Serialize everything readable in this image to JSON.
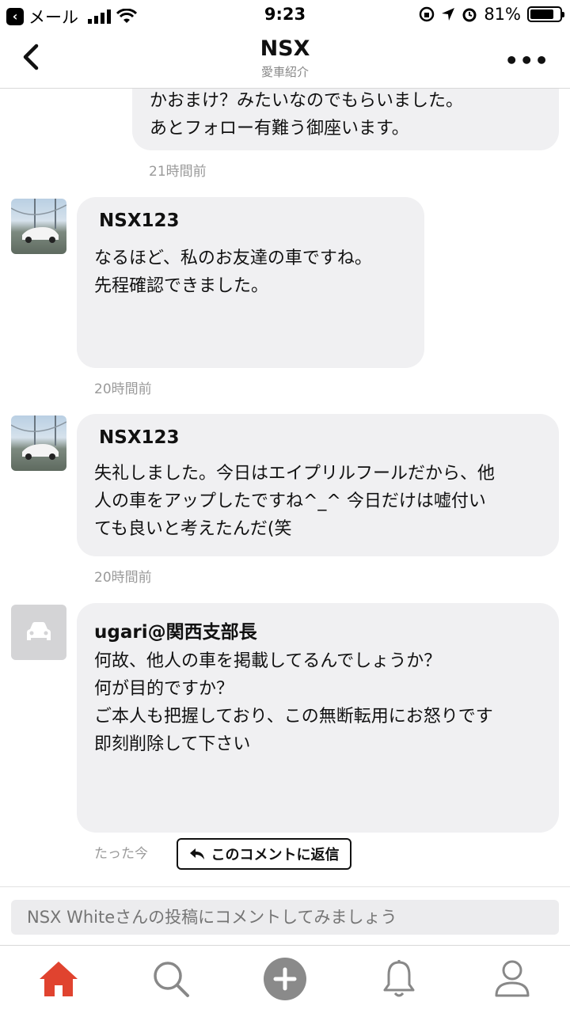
{
  "status_bar": {
    "back_app": "メール",
    "time": "9:23",
    "battery": "81%",
    "battery_level": 0.81
  },
  "nav": {
    "title": "NSX",
    "subtitle": "愛車紹介"
  },
  "comments": [
    {
      "text": "かおまけ？みたいなのでもらいました。\nあとフォロー有難う御座います。",
      "time": "21時間前"
    },
    {
      "author": "NSX123",
      "text": "なるほど、私のお友達の車ですね。\n先程確認できました。",
      "time": "20時間前"
    },
    {
      "author": "NSX123",
      "text": "失礼しました。今日はエイプリルフールだから、他\n人の車をアップしたですね^_^  今日だけは嘘付い\nても良いと考えたんだ(笑",
      "time": "20時間前"
    },
    {
      "author": "ugari@関西支部長",
      "text": "何故、他人の車を掲載してるんでしょうか？\n何が目的ですか？\nご本人も把握しており、この無断転用にお怒りです\n即刻削除して下さい",
      "time": "たった今"
    }
  ],
  "reply_button": "このコメントに返信",
  "comment_input": {
    "placeholder": "NSX Whiteさんの投稿にコメントしてみましょう"
  },
  "tabs": [
    {
      "icon": "home-icon",
      "active": true
    },
    {
      "icon": "search-icon"
    },
    {
      "icon": "plus-icon"
    },
    {
      "icon": "bell-icon"
    },
    {
      "icon": "profile-icon"
    }
  ],
  "colors": {
    "accent": "#e0432f",
    "bubble": "#f0f0f2",
    "timestamp": "#9a9a9a"
  }
}
